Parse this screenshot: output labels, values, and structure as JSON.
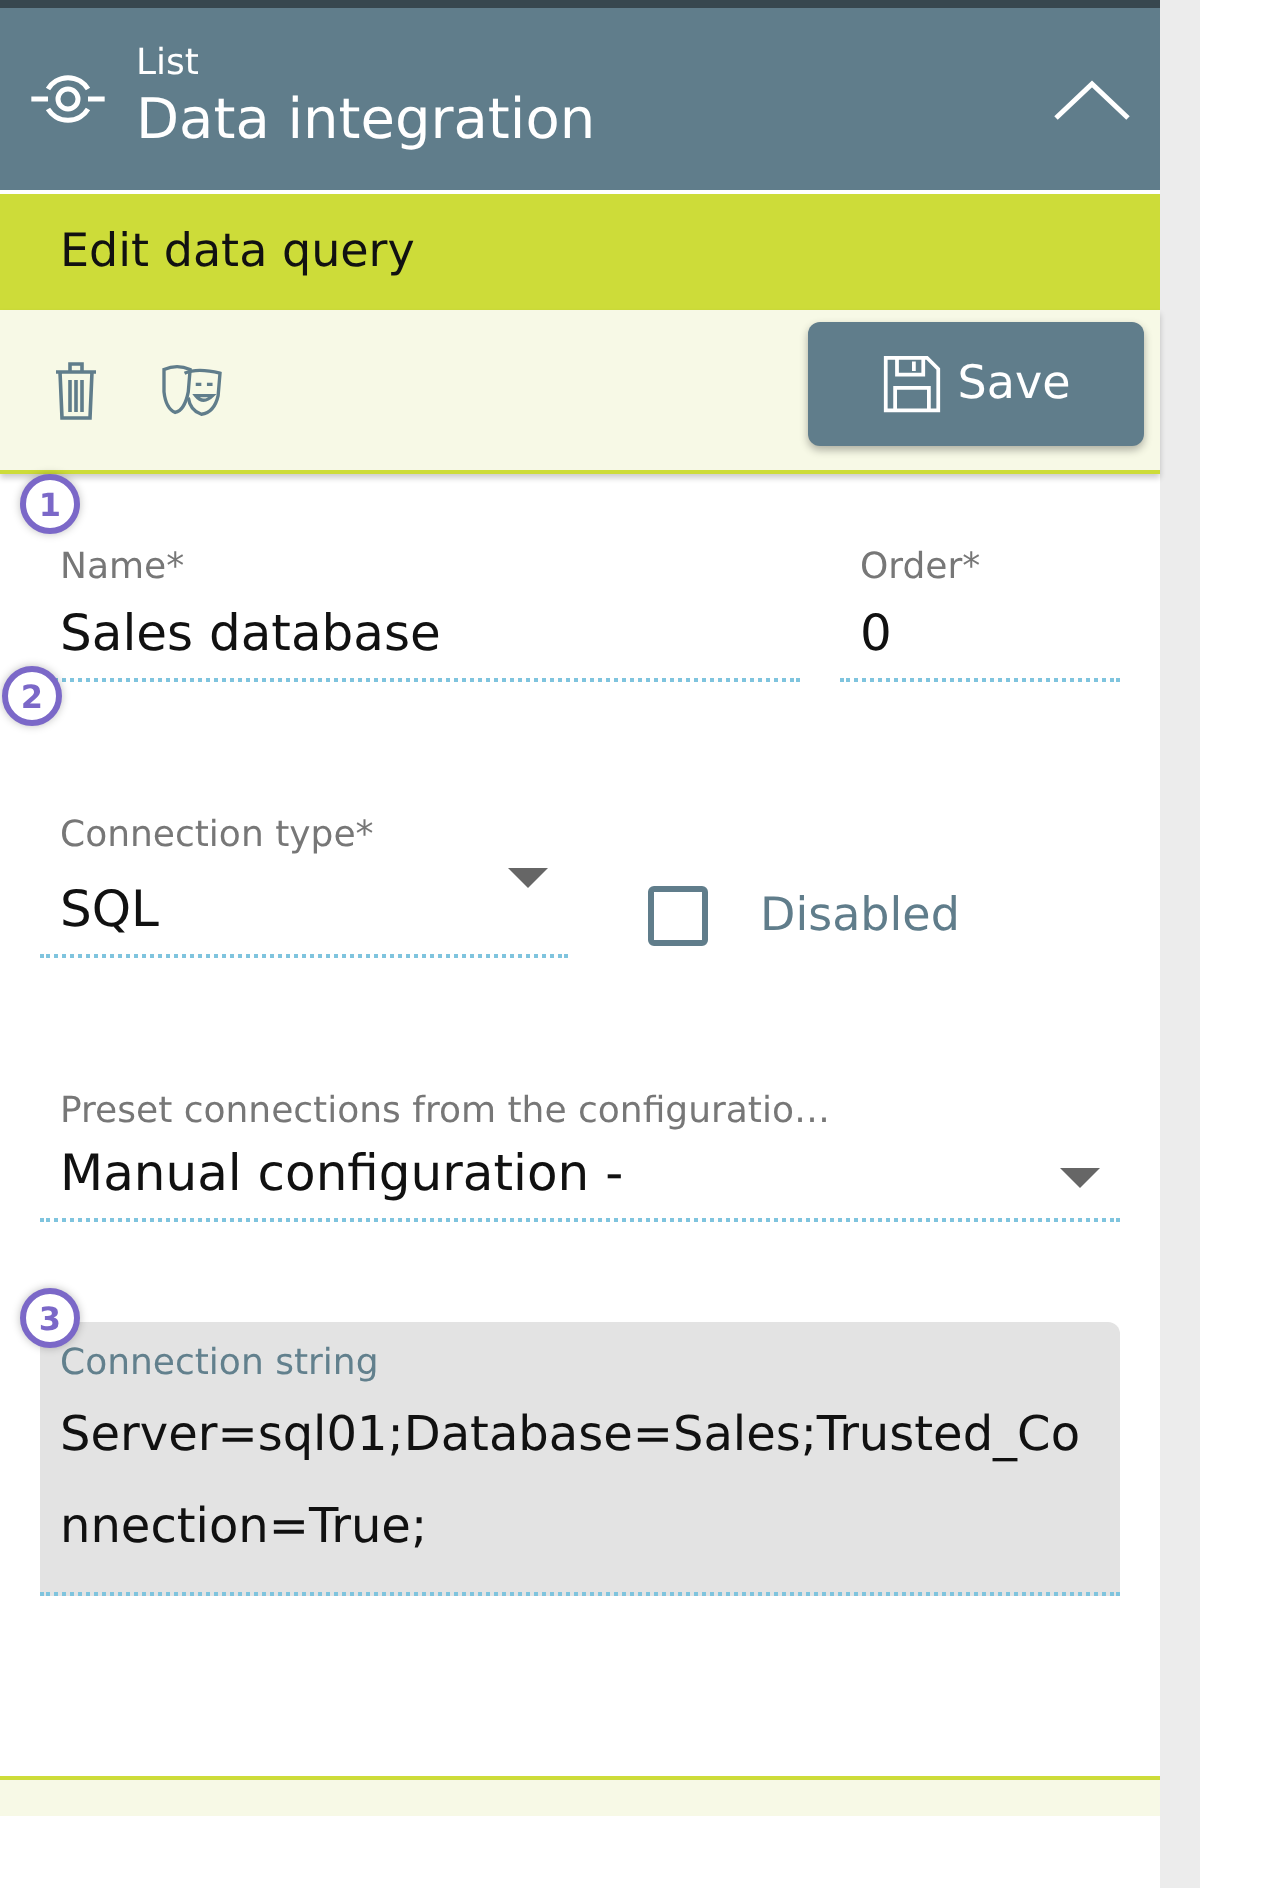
{
  "header": {
    "subtitle": "List",
    "title": "Data integration",
    "expanded": true
  },
  "section": {
    "title": "Edit data query"
  },
  "toolbar": {
    "save_label": "Save"
  },
  "name_field": {
    "label": "Name*",
    "value": "Sales database"
  },
  "order_field": {
    "label": "Order*",
    "value": "0"
  },
  "connection_type": {
    "label": "Connection type*",
    "value": "SQL"
  },
  "disabled_checkbox": {
    "label": "Disabled",
    "checked": false
  },
  "preset_connections": {
    "label": "Preset connections from the configuratio…",
    "value": "Manual configuration -"
  },
  "connection_string": {
    "label": "Connection string",
    "value": "Server=sql01;Database=Sales;Trusted_Connection=True;",
    "disabled": true
  },
  "markers": [
    "1",
    "2",
    "3"
  ]
}
